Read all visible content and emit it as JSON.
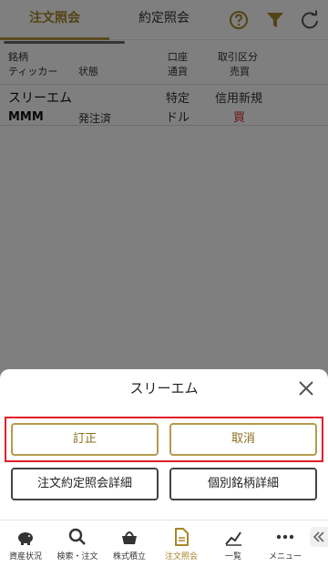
{
  "tabs": {
    "orders": "注文照会",
    "executions": "約定照会"
  },
  "columns": {
    "name": "銘柄",
    "ticker": "ティッカー",
    "status": "状態",
    "account": "口座",
    "currency": "通貨",
    "trade_type": "取引区分",
    "side": "売買"
  },
  "order": {
    "name": "スリーエム",
    "ticker": "MMM",
    "status": "発注済",
    "account": "特定",
    "currency": "ドル",
    "trade_type": "信用新規",
    "side": "買"
  },
  "sheet": {
    "title": "スリーエム",
    "revise": "訂正",
    "cancel": "取消",
    "order_detail": "注文約定照会詳細",
    "stock_detail": "個別銘柄詳細"
  },
  "nav": {
    "assets": "資産状況",
    "search": "検索・注文",
    "accumulation": "株式積立",
    "orders": "注文照会",
    "list": "一覧",
    "menu": "メニュー"
  },
  "colors": {
    "accent": "#a8862a",
    "sell_buy": "#d22222",
    "highlight": "#e0202a"
  }
}
